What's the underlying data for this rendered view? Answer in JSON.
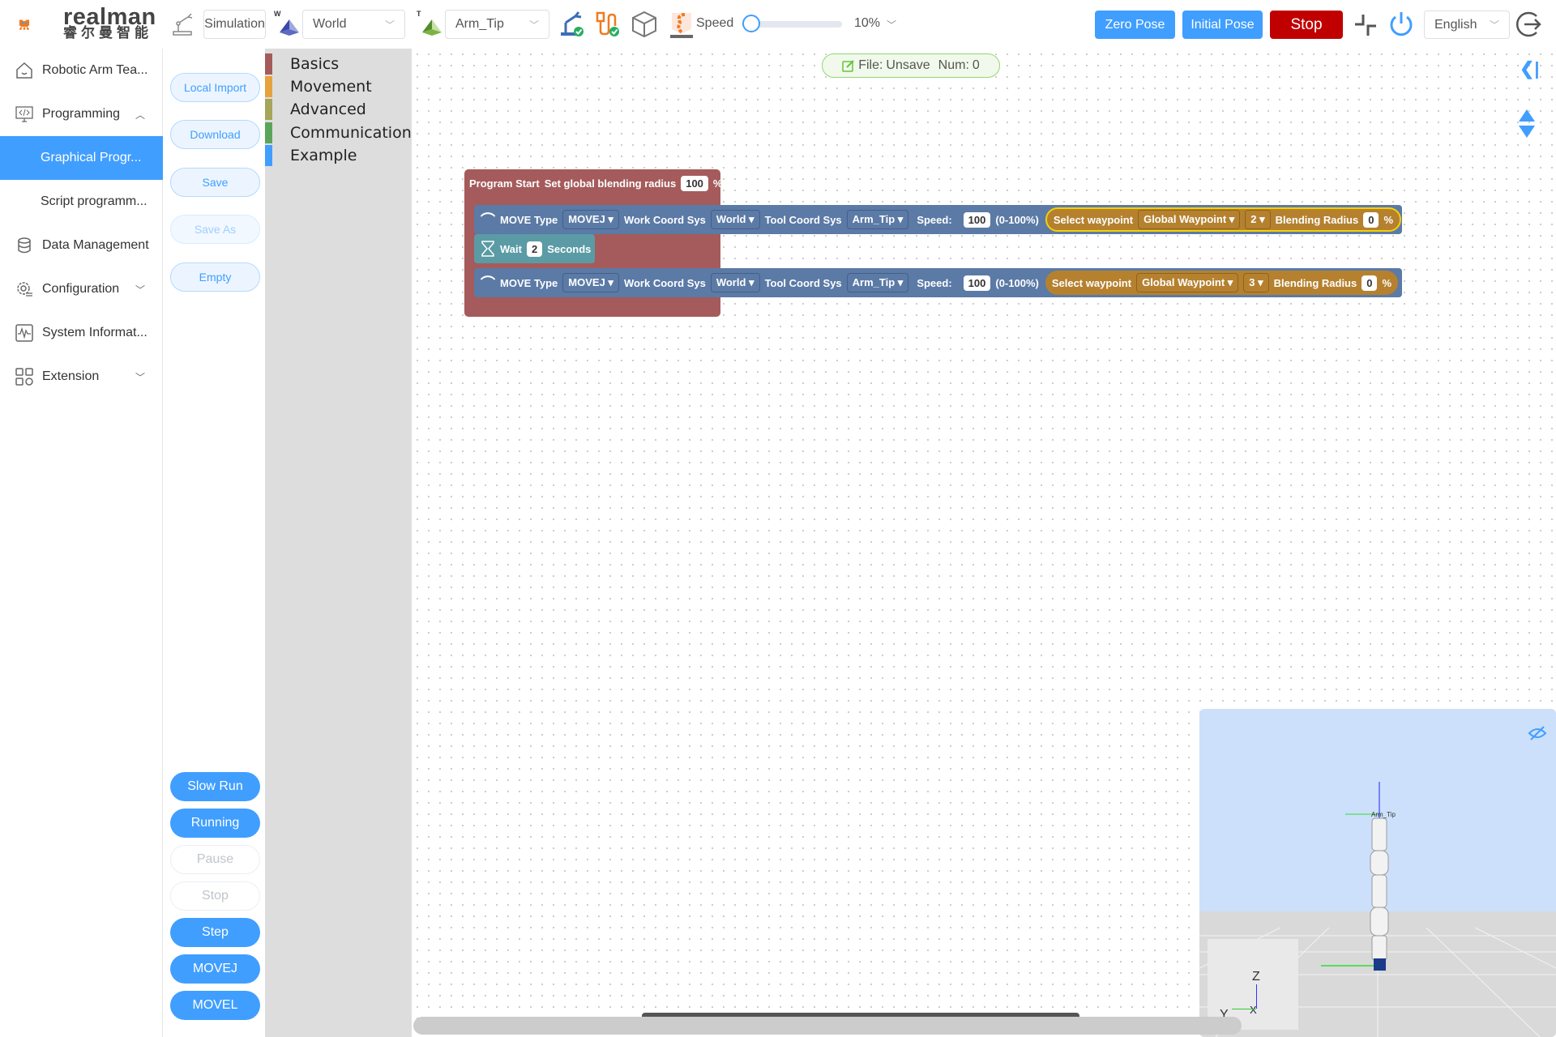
{
  "brand": {
    "name": "realman",
    "subtitle": "睿尔曼智能",
    "primary": "#409eff",
    "stop": "#c00000"
  },
  "topbar": {
    "mode": "Simulation",
    "work_coord_label": "W",
    "work_coord": "World",
    "tool_coord_label": "T",
    "tool_coord": "Arm_Tip",
    "speed_label": "Speed",
    "speed_value": "10%",
    "speed_fraction": 0.1,
    "zero_pose": "Zero Pose",
    "initial_pose": "Initial Pose",
    "stop": "Stop",
    "language": "English"
  },
  "sidebar": {
    "items": [
      {
        "label": "Robotic Arm Tea...",
        "icon": "home-icon"
      },
      {
        "label": "Programming",
        "icon": "code-monitor-icon",
        "expanded": true
      },
      {
        "label": "Graphical Progr...",
        "active": true
      },
      {
        "label": "Script programm..."
      },
      {
        "label": "Data Management",
        "icon": "database-icon"
      },
      {
        "label": "Configuration",
        "icon": "gear-icon"
      },
      {
        "label": "System Informat...",
        "icon": "pulse-icon"
      },
      {
        "label": "Extension",
        "icon": "grid-icon"
      }
    ]
  },
  "actions": {
    "local_import": "Local Import",
    "download": "Download",
    "save": "Save",
    "save_as": "Save As",
    "empty": "Empty",
    "slow_run": "Slow Run",
    "running": "Running",
    "pause": "Pause",
    "stop": "Stop",
    "step": "Step",
    "movej": "MOVEJ",
    "movel": "MOVEL"
  },
  "toolbox": {
    "categories": [
      {
        "label": "Basics",
        "color": "#a55b5b"
      },
      {
        "label": "Movement",
        "color": "#e6a23c"
      },
      {
        "label": "Advanced",
        "color": "#a5a55b"
      },
      {
        "label": "Communication",
        "color": "#5ba55b"
      },
      {
        "label": "Example",
        "color": "#409eff"
      }
    ]
  },
  "file_status": {
    "file_label": "File:",
    "file_value": "Unsave",
    "num_label": "Num:",
    "num_value": "0"
  },
  "program": {
    "start": {
      "label": "Program Start",
      "blend_label": "Set global blending radius",
      "blend_value": "100",
      "unit": "%"
    },
    "move_type_label": "MOVE Type",
    "work_label": "Work Coord Sys",
    "tool_label": "Tool Coord Sys",
    "speed_label": "Speed:",
    "speed_range": "(0-100%)",
    "wp_label": "Select waypoint",
    "blend_label": "Blending Radius",
    "pct": "%",
    "moves": [
      {
        "type": "MOVEJ",
        "work": "World",
        "tool": "Arm_Tip",
        "speed": "100",
        "waypoint_set": "Global Waypoint",
        "waypoint": "2",
        "blend": "0"
      },
      {
        "type": "MOVEJ",
        "work": "World",
        "tool": "Arm_Tip",
        "speed": "100",
        "waypoint_set": "Global Waypoint",
        "waypoint": "3",
        "blend": "0"
      }
    ],
    "wait": {
      "label": "Wait",
      "value": "2",
      "unit": "Seconds"
    }
  },
  "sim": {
    "tip_label": "Arm_Tip",
    "axis_z": "Z",
    "axis_y": "Y",
    "axis_x": "X"
  }
}
